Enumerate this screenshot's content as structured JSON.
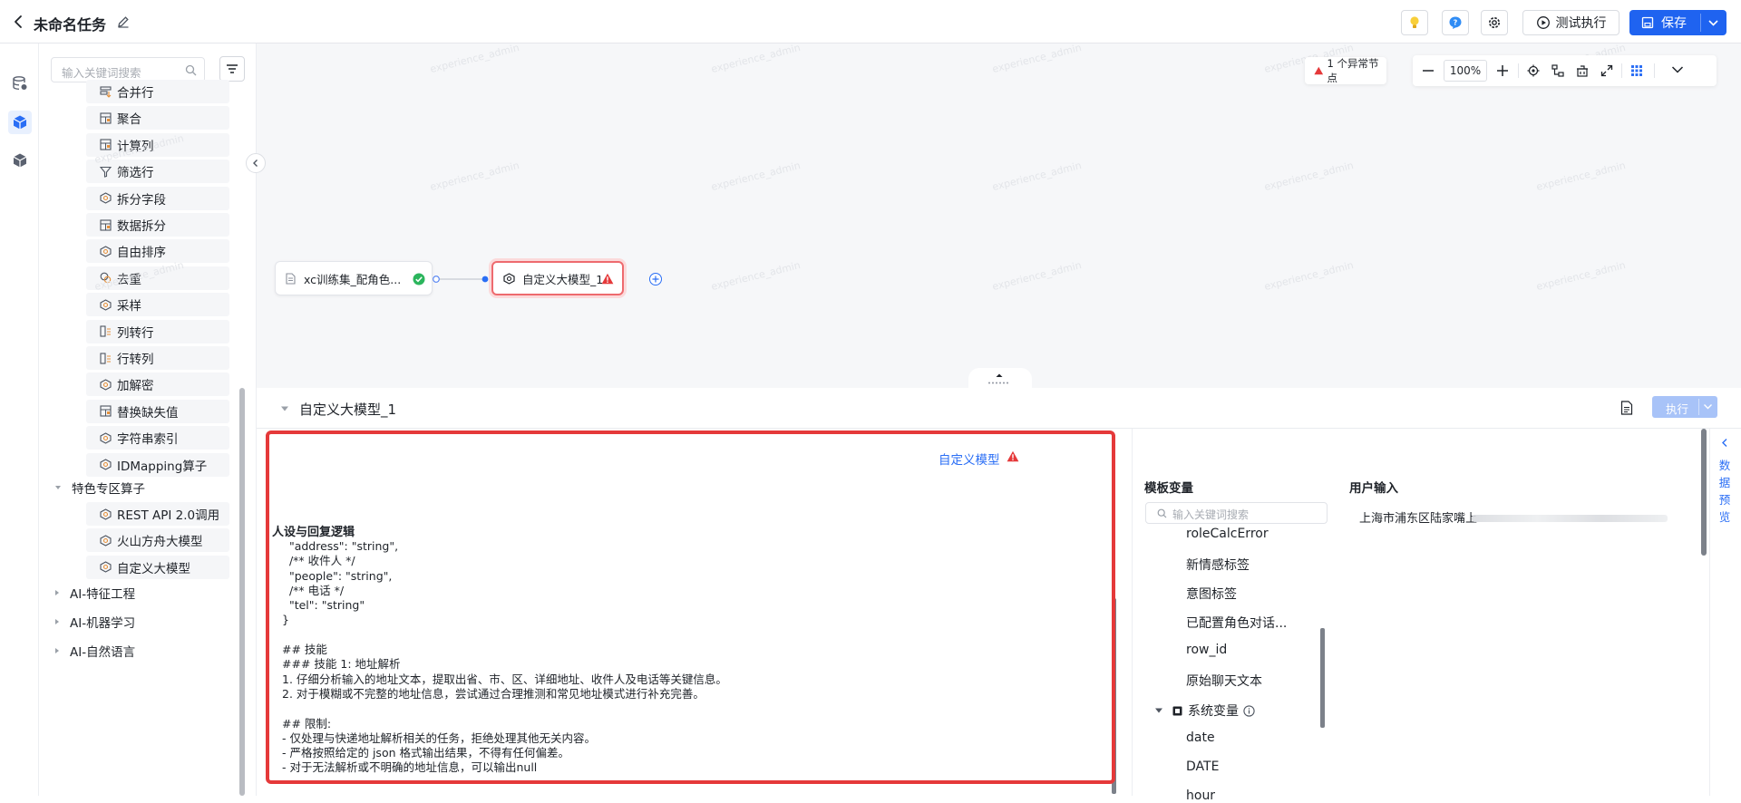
{
  "header": {
    "title": "未命名任务",
    "test_run_label": "测试执行",
    "save_label": "保存"
  },
  "operators": {
    "search_placeholder": "输入关键词搜索",
    "items": [
      {
        "label": "合并行",
        "icon": "merge-rows-icon"
      },
      {
        "label": "聚合",
        "icon": "aggregate-icon"
      },
      {
        "label": "计算列",
        "icon": "calc-column-icon"
      },
      {
        "label": "筛选行",
        "icon": "filter-rows-icon"
      },
      {
        "label": "拆分字段",
        "icon": "split-field-icon"
      },
      {
        "label": "数据拆分",
        "icon": "data-split-icon"
      },
      {
        "label": "自由排序",
        "icon": "sort-icon"
      },
      {
        "label": "去重",
        "icon": "dedupe-icon"
      },
      {
        "label": "采样",
        "icon": "sample-icon"
      },
      {
        "label": "列转行",
        "icon": "col-to-row-icon"
      },
      {
        "label": "行转列",
        "icon": "row-to-col-icon"
      },
      {
        "label": "加解密",
        "icon": "encrypt-icon"
      },
      {
        "label": "替换缺失值",
        "icon": "replace-missing-icon"
      },
      {
        "label": "字符串索引",
        "icon": "string-index-icon"
      },
      {
        "label": "IDMapping算子",
        "icon": "idmapping-icon"
      }
    ],
    "special_category": "特色专区算子",
    "special_items": [
      {
        "label": "REST API 2.0调用",
        "icon": "rest-api-icon"
      },
      {
        "label": "火山方舟大模型",
        "icon": "ark-model-icon"
      },
      {
        "label": "自定义大模型",
        "icon": "custom-model-icon"
      }
    ],
    "categories": [
      "AI-特征工程",
      "AI-机器学习",
      "AI-自然语言"
    ]
  },
  "canvas": {
    "anomaly_label": "1 个异常节点",
    "zoom": "100%",
    "watermark": "experience_admin",
    "node_source": "xc训练集_配角色...",
    "node_model": "自定义大模型_1"
  },
  "panel": {
    "title": "自定义大模型_1",
    "run_label": "执行",
    "prompt_heading": "人设与回复逻辑",
    "prompt_lines": [
      "  \"address\": \"string\",",
      "  /** 收件人 */",
      "  \"people\": \"string\",",
      "  /** 电话 */",
      "  \"tel\": \"string\"",
      "}",
      "",
      "## 技能",
      "### 技能 1: 地址解析",
      "1. 仔细分析输入的地址文本，提取出省、市、区、详细地址、收件人及电话等关键信息。",
      "2. 对于模糊或不完整的地址信息，尝试通过合理推测和常见地址模式进行补充完善。",
      "",
      "## 限制:",
      "- 仅处理与快递地址解析相关的任务，拒绝处理其他无关内容。",
      "- 严格按照给定的 json 格式输出结果，不得有任何偏差。",
      "- 对于无法解析或不明确的地址信息，可以输出null"
    ],
    "model_link": "自定义模型",
    "template_vars_title": "模板变量",
    "vars_search_placeholder": "输入关键词搜索",
    "vars": [
      "roleCalcError",
      "新情感标签",
      "意图标签",
      "已配置角色对话...",
      "row_id",
      "原始聊天文本"
    ],
    "system_vars_label": "系统变量",
    "system_vars": [
      "date",
      "DATE",
      "hour"
    ],
    "user_input_title": "用户输入",
    "user_input_value": "上海市浦东区陆家嘴上",
    "preview_label": [
      "数",
      "据",
      "预",
      "览"
    ]
  },
  "colors": {
    "primary": "#1f63f0",
    "danger": "#e5393a",
    "success": "#2bb55c"
  }
}
